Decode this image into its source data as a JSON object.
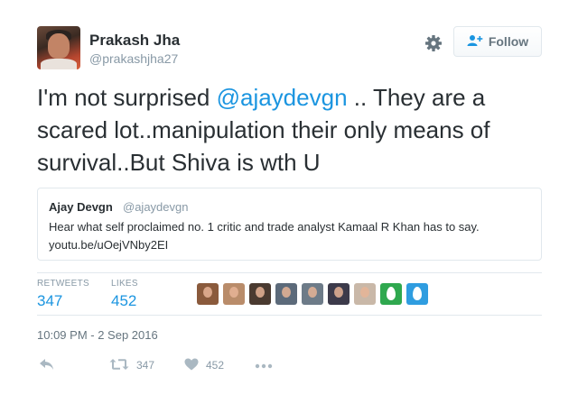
{
  "user": {
    "display_name": "Prakash Jha",
    "handle": "@prakashjha27"
  },
  "follow_button": {
    "label": "Follow"
  },
  "tweet": {
    "text_before": "I'm not surprised ",
    "mention": "@ajaydevgn",
    "text_after": " .. They are a scared lot..manipulation their only means of survival..But Shiva is wth U"
  },
  "quoted_tweet": {
    "name": "Ajay Devgn",
    "handle": "@ajaydevgn",
    "text": "Hear what self proclaimed no. 1 critic and trade analyst Kamaal R Khan has to say.",
    "link": "youtu.be/uOejVNby2EI"
  },
  "stats": {
    "retweets_label": "RETWEETS",
    "retweets_value": "347",
    "likes_label": "LIKES",
    "likes_value": "452"
  },
  "likers": [
    {
      "kind": "photo",
      "color": "#8a5a3c"
    },
    {
      "kind": "photo",
      "color": "#b98c6a"
    },
    {
      "kind": "photo",
      "color": "#4a3a30"
    },
    {
      "kind": "photo",
      "color": "#5c6a7a"
    },
    {
      "kind": "photo",
      "color": "#6d7b88"
    },
    {
      "kind": "photo",
      "color": "#3c3a4a"
    },
    {
      "kind": "photo",
      "color": "#c9b8a8"
    },
    {
      "kind": "egg",
      "color": "#2fa84f"
    },
    {
      "kind": "egg",
      "color": "#2f9de0"
    }
  ],
  "timestamp": "10:09 PM - 2 Sep 2016",
  "actions": {
    "reply_icon": "reply-icon",
    "retweet_count": "347",
    "like_count": "452",
    "more_icon": "more-icon"
  },
  "colors": {
    "link": "#1b95e0",
    "secondary_text": "#8899a6",
    "border": "#e1e8ed"
  }
}
